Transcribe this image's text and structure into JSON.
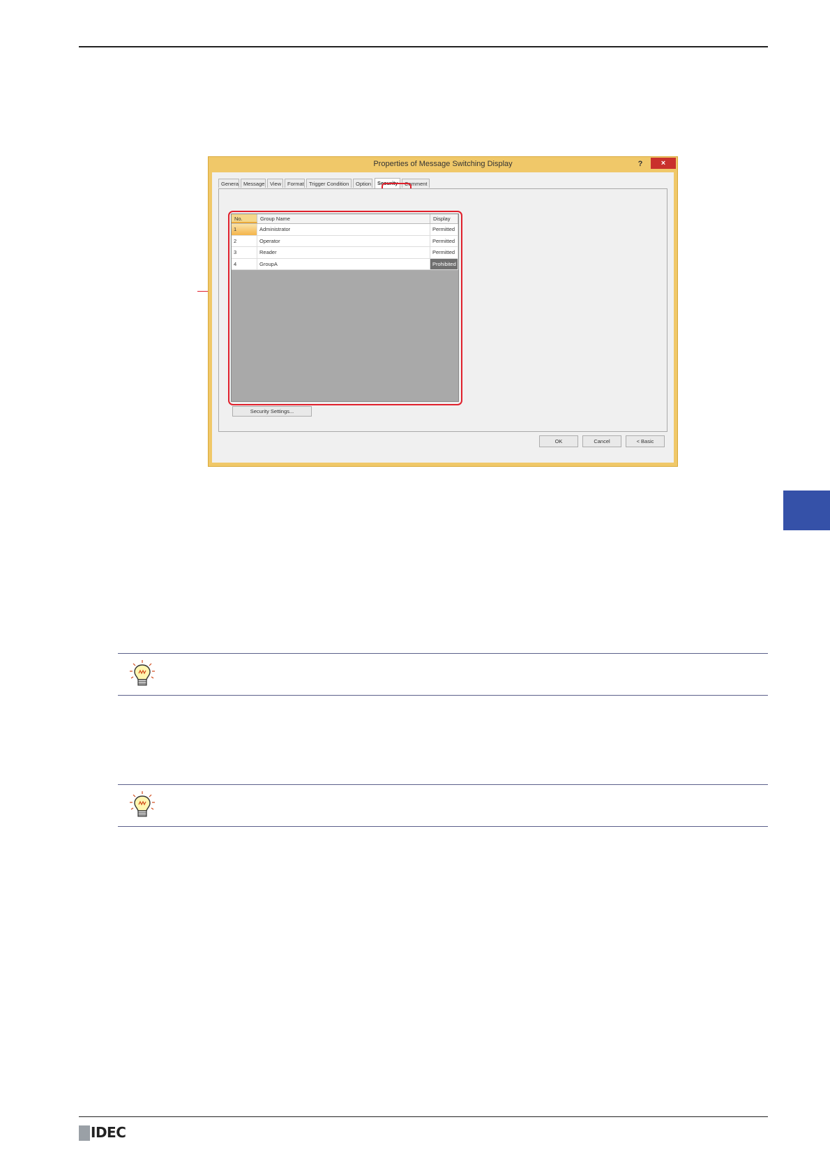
{
  "dialog": {
    "title": "Properties of Message Switching Display",
    "help_glyph": "?",
    "close_glyph": "×",
    "tabs": [
      "General",
      "Message",
      "View",
      "Format",
      "Trigger Condition",
      "Option",
      "Security",
      "Comment"
    ],
    "active_tab": "Security"
  },
  "grid": {
    "headers": {
      "no": "No.",
      "name": "Group Name",
      "display": "Display"
    },
    "rows": [
      {
        "no": "1",
        "name": "Administrator",
        "display": "Permitted"
      },
      {
        "no": "2",
        "name": "Operator",
        "display": "Permitted"
      },
      {
        "no": "3",
        "name": "Reader",
        "display": "Permitted"
      },
      {
        "no": "4",
        "name": "GroupA",
        "display": "Prohibited"
      }
    ]
  },
  "buttons": {
    "security_settings": "Security Settings...",
    "ok": "OK",
    "cancel": "Cancel",
    "basic": "< Basic"
  },
  "brand": {
    "logo_text": "IDEC"
  },
  "colors": {
    "accent_side_tab": "#3551a8",
    "callout": "#e0202c",
    "window_frame": "#f0c869",
    "prohibited_cell": "#6f6f6f"
  },
  "icons": [
    "hint-lightbulb-icon",
    "close-icon",
    "help-icon"
  ]
}
